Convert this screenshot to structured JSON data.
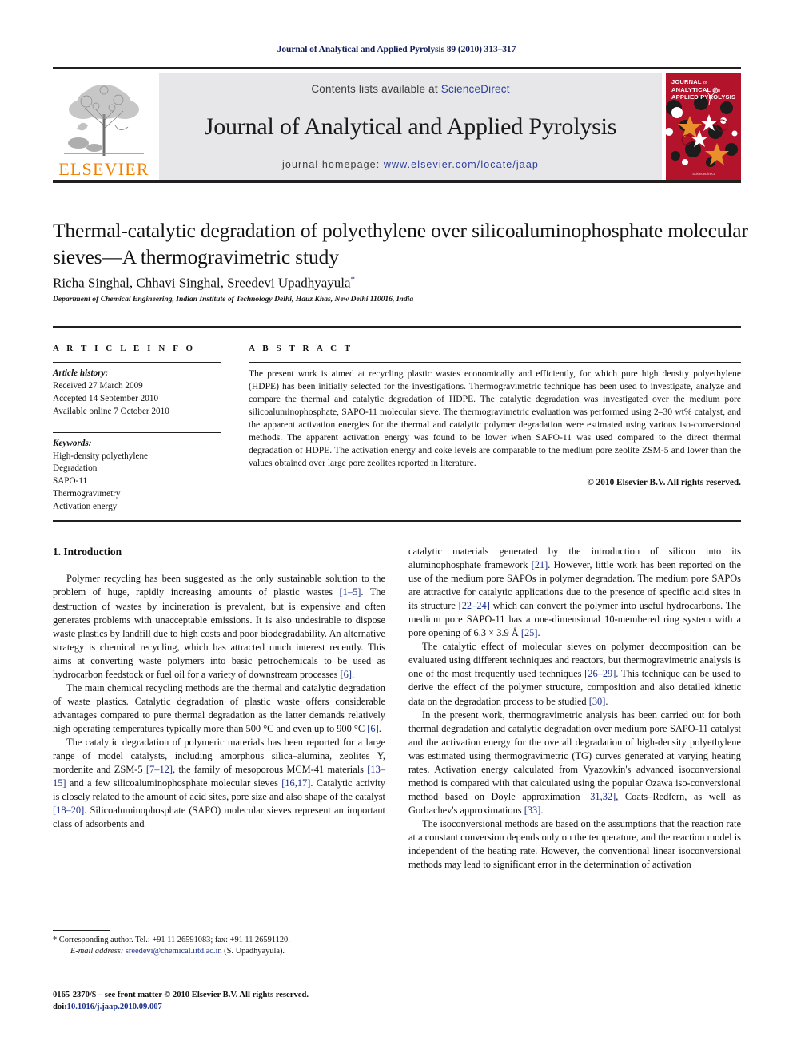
{
  "running_head": "Journal of Analytical and Applied Pyrolysis 89 (2010) 313–317",
  "masthead": {
    "publisher_name": "ELSEVIER",
    "contents_prefix": "Contents lists available at ",
    "contents_link": "ScienceDirect",
    "journal_title": "Journal of Analytical and Applied Pyrolysis",
    "homepage_prefix": "journal homepage: ",
    "homepage_url": "www.elsevier.com/locate/jaap",
    "cover": {
      "line1": "JOURNAL",
      "line1_small": "of",
      "line2": "ANALYTICAL",
      "line2_small": "and",
      "line3": "APPLIED PYROLYSIS",
      "footer": "ScienceDirect"
    }
  },
  "article": {
    "title": "Thermal-catalytic degradation of polyethylene over silicoaluminophosphate molecular sieves—A thermogravimetric study",
    "authors": "Richa Singhal, Chhavi Singhal, Sreedevi Upadhyayula",
    "corresponding_marker": "*",
    "affiliation": "Department of Chemical Engineering, Indian Institute of Technology Delhi, Hauz Khas, New Delhi 110016, India"
  },
  "article_info": {
    "heading": "A R T I C L E    I N F O",
    "history_label": "Article history:",
    "history": [
      "Received 27 March 2009",
      "Accepted 14 September 2010",
      "Available online 7 October 2010"
    ],
    "keywords_label": "Keywords:",
    "keywords": [
      "High-density polyethylene",
      "Degradation",
      "SAPO-11",
      "Thermogravimetry",
      "Activation energy"
    ]
  },
  "abstract": {
    "heading": "A B S T R A C T",
    "text": "The present work is aimed at recycling plastic wastes economically and efficiently, for which pure high density polyethylene (HDPE) has been initially selected for the investigations. Thermogravimetric technique has been used to investigate, analyze and compare the thermal and catalytic degradation of HDPE. The catalytic degradation was investigated over the medium pore silicoaluminophosphate, SAPO-11 molecular sieve. The thermogravimetric evaluation was performed using 2–30 wt% catalyst, and the apparent activation energies for the thermal and catalytic polymer degradation were estimated using various iso-conversional methods. The apparent activation energy was found to be lower when SAPO-11 was used compared to the direct thermal degradation of HDPE. The activation energy and coke levels are comparable to the medium pore zeolite ZSM-5 and lower than the values obtained over large pore zeolites reported in literature.",
    "copyright": "© 2010 Elsevier B.V. All rights reserved."
  },
  "body": {
    "section_heading": "1.  Introduction",
    "left_paragraphs": [
      "Polymer recycling has been suggested as the only sustainable solution to the problem of huge, rapidly increasing amounts of plastic wastes [1–5]. The destruction of wastes by incineration is prevalent, but is expensive and often generates problems with unacceptable emissions. It is also undesirable to dispose waste plastics by landfill due to high costs and poor biodegradability. An alternative strategy is chemical recycling, which has attracted much interest recently. This aims at converting waste polymers into basic petrochemicals to be used as hydrocarbon feedstock or fuel oil for a variety of downstream processes [6].",
      "The main chemical recycling methods are the thermal and catalytic degradation of waste plastics. Catalytic degradation of plastic waste offers considerable advantages compared to pure thermal degradation as the latter demands relatively high operating temperatures typically more than 500 °C and even up to 900 °C [6].",
      "The catalytic degradation of polymeric materials has been reported for a large range of model catalysts, including amorphous silica–alumina, zeolites Y, mordenite and ZSM-5 [7–12], the family of mesoporous MCM-41 materials [13–15] and a few silicoaluminophosphate molecular sieves [16,17]. Catalytic activity is closely related to the amount of acid sites, pore size and also shape of the catalyst [18–20]. Silicoaluminophosphate (SAPO) molecular sieves represent an important class of adsorbents and"
    ],
    "right_paragraphs": [
      "catalytic materials generated by the introduction of silicon into its aluminophosphate framework [21]. However, little work has been reported on the use of the medium pore SAPOs in polymer degradation. The medium pore SAPOs are attractive for catalytic applications due to the presence of specific acid sites in its structure [22–24] which can convert the polymer into useful hydrocarbons. The medium pore SAPO-11 has a one-dimensional 10-membered ring system with a pore opening of 6.3 × 3.9 Å [25].",
      "The catalytic effect of molecular sieves on polymer decomposition can be evaluated using different techniques and reactors, but thermogravimetric analysis is one of the most frequently used techniques [26–29]. This technique can be used to derive the effect of the polymer structure, composition and also detailed kinetic data on the degradation process to be studied [30].",
      "In the present work, thermogravimetric analysis has been carried out for both thermal degradation and catalytic degradation over medium pore SAPO-11 catalyst and the activation energy for the overall degradation of high-density polyethylene was estimated using thermogravimetric (TG) curves generated at varying heating rates. Activation energy calculated from Vyazovkin's advanced isoconversional method is compared with that calculated using the popular Ozawa iso-conversional method based on Doyle approximation [31,32], Coats–Redfern, as well as Gorbachev's approximations [33].",
      "The isoconversional methods are based on the assumptions that the reaction rate at a constant conversion depends only on the temperature, and the reaction model is independent of the heating rate. However, the conventional linear isoconversional methods may lead to significant error in the determination of activation"
    ]
  },
  "footnote": {
    "corresponding": "* Corresponding author. Tel.: +91 11 26591083; fax: +91 11 26591120.",
    "email_label": "E-mail address:",
    "email": "sreedevi@chemical.iitd.ac.in",
    "email_suffix": " (S. Upadhyayula).",
    "imprint_line1": "0165-2370/$ – see front matter © 2010 Elsevier B.V. All rights reserved.",
    "doi_label": "doi:",
    "doi": "10.1016/j.jaap.2010.09.007"
  },
  "colors": {
    "link": "#1b2f8c",
    "running_head": "#15205c",
    "elsevier_orange": "#f08100",
    "cover_red": "#b4132c",
    "band_gray": "#e7e7e9"
  }
}
